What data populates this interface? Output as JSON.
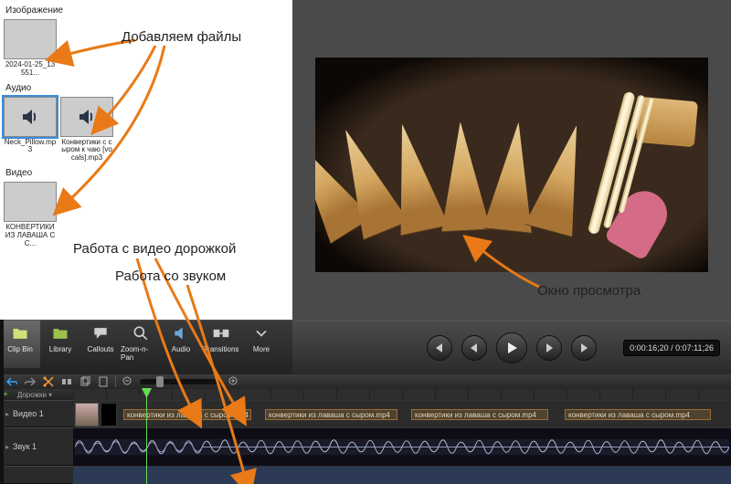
{
  "media_panel": {
    "sections": {
      "image_label": "Изображение",
      "audio_label": "Аудио",
      "video_label": "Видео"
    },
    "image_items": [
      {
        "caption": "2024-01-25_13551..."
      }
    ],
    "audio_items": [
      {
        "caption": "Neck_Pillow.mp3"
      },
      {
        "caption": "Конвертики с сыром к чаю [vocals].mp3"
      }
    ],
    "video_items": [
      {
        "caption": "КОНВЕРТИКИ ИЗ ЛАВАША С С..."
      }
    ]
  },
  "annotations": {
    "add_files": "Добавляем файлы",
    "video_track": "Работа с видео дорожкой",
    "audio_track": "Работа со звуком",
    "preview": "Окно просмотра"
  },
  "toolbar": {
    "clip_bin": "Clip Bin",
    "library": "Library",
    "callouts": "Callouts",
    "zoom": "Zoom-n-Pan",
    "audio": "Audio",
    "transitions": "Transitions",
    "more": "More"
  },
  "transport": {
    "time_display": "0:00:16;20 / 0:07:11;26"
  },
  "timeline": {
    "tracks_add_label": "Дорожки",
    "video_track_label": "Видео 1",
    "audio_track_label": "Звук 1",
    "video_clip_label": "конвертики из лаваша с сыром.mp4"
  },
  "colors": {
    "arrow": "#e97a17"
  }
}
